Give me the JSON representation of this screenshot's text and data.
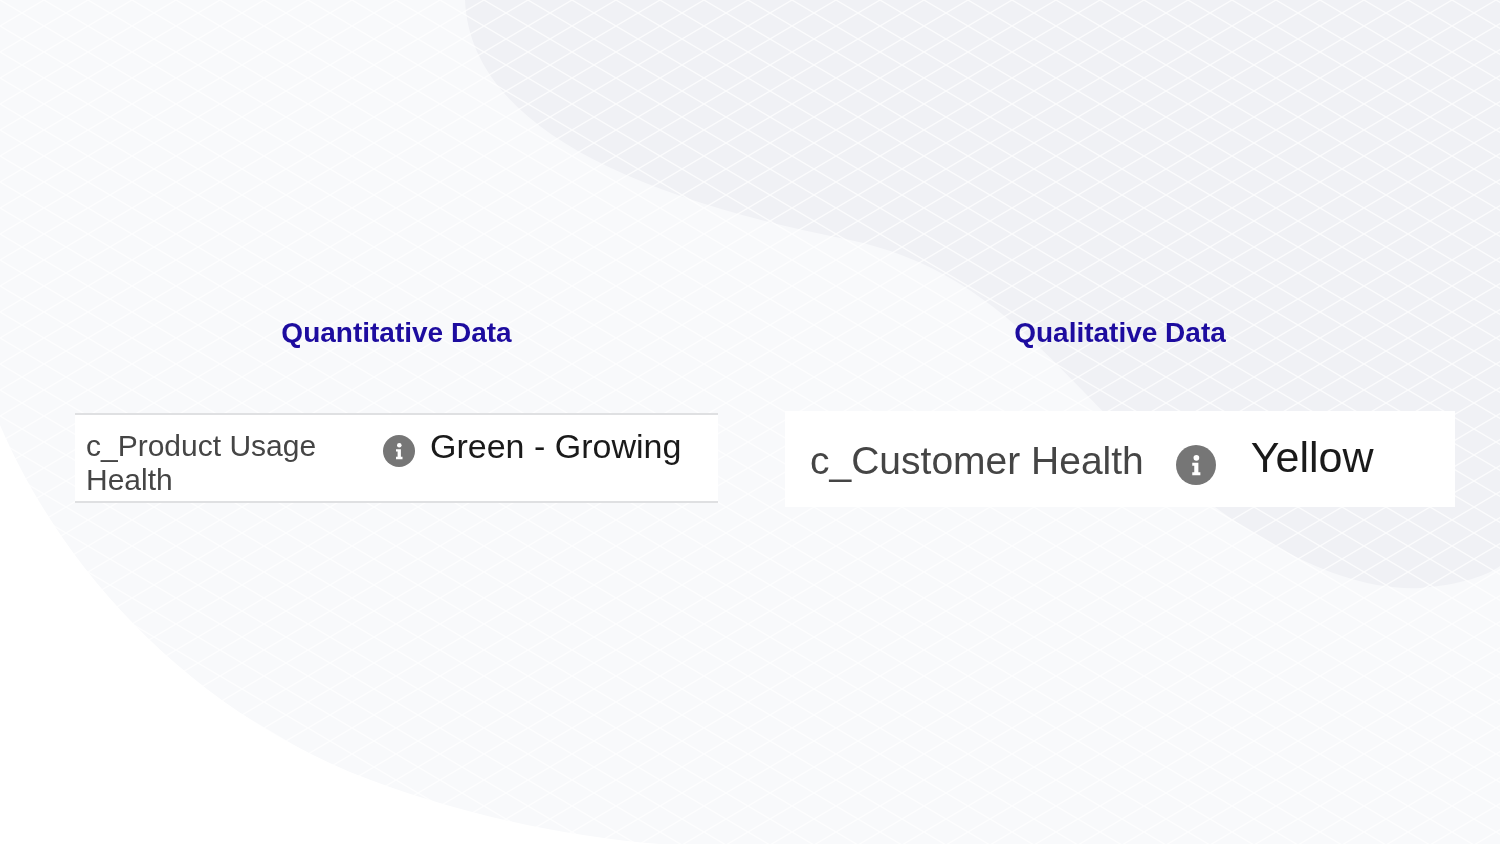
{
  "panels": [
    {
      "heading": "Quantitative Data",
      "kind": "bordered",
      "field": {
        "label": "c_Product Usage Health",
        "value": "Green - Growing"
      }
    },
    {
      "heading": "Qualitative Data",
      "kind": "card",
      "field": {
        "label": "c_Customer Health",
        "value": "Yellow"
      }
    }
  ]
}
